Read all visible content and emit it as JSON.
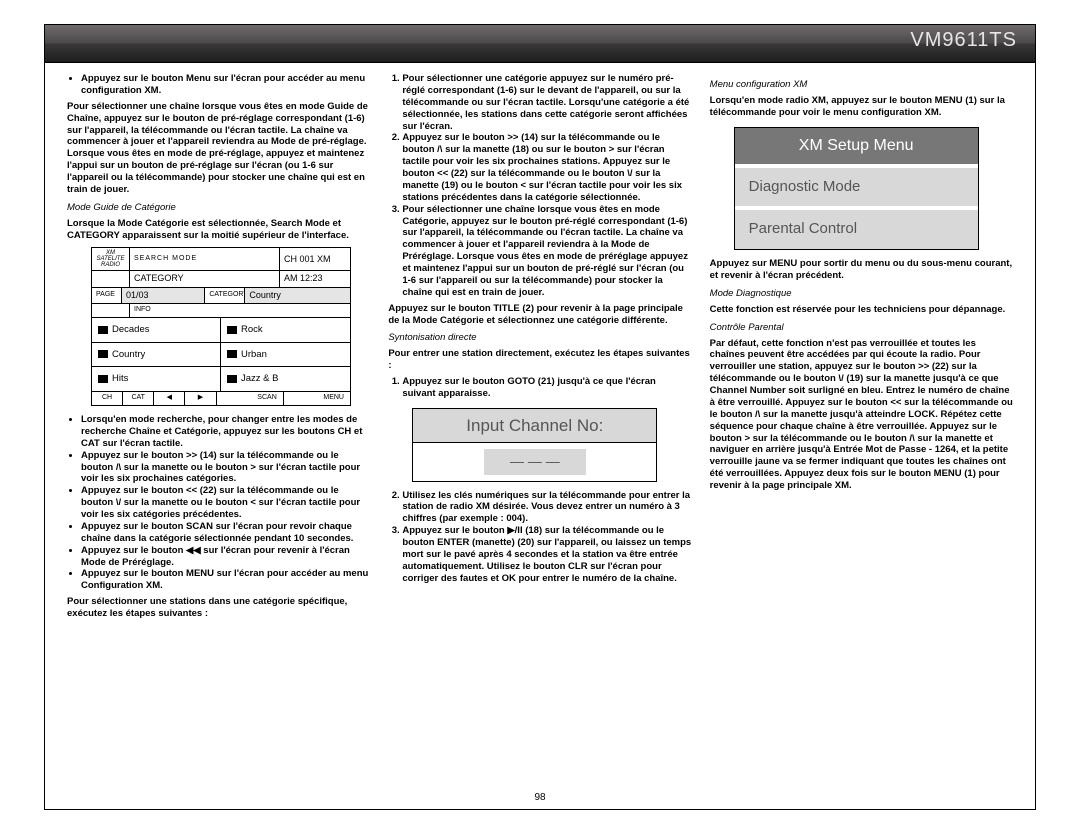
{
  "header": {
    "product_id": "VM9611TS"
  },
  "page_number": "98",
  "col1": {
    "bullet1": "Appuyez sur le bouton Menu sur l'écran pour accéder au menu configuration XM.",
    "para1": "Pour sélectionner une chaîne lorsque vous êtes en mode Guide de Chaîne, appuyez sur le bouton de pré-réglage correspondant (1-6) sur l'appareil, la télécommande ou l'écran tactile. La chaîne va commencer à jouer et l'appareil reviendra au Mode de pré-réglage. Lorsque vous êtes en mode de pré-réglage, appuyez et maintenez l'appui sur un bouton de pré-réglage sur l'écran (ou 1-6 sur l'appareil ou la télécommande) pour stocker une chaîne qui est en train de jouer.",
    "sec_label": "Mode Guide de Catégorie",
    "para2": "Lorsque la Mode Catégorie est sélectionnée, Search Mode et CATEGORY apparaissent sur la moitié supérieur de l'interface.",
    "diagram": {
      "logo": "XM SATELITE RADIO",
      "search_mode": "SEARCH MODE",
      "ch": "CH 001   XM",
      "category": "CATEGORY",
      "time": "AM 12:23",
      "page_lbl": "PAGE",
      "page_val": "01/03",
      "cat_lbl": "CATEGORY",
      "cat_val": "Country",
      "info": "INFO",
      "folders": [
        "Decades",
        "Rock",
        "Country",
        "Urban",
        "Hits",
        "Jazz & B"
      ],
      "btns": [
        "CH",
        "CAT",
        "◀",
        "▶",
        "SCAN",
        "MENU"
      ]
    },
    "b2": "Lorsqu'en mode recherche, pour changer entre les modes de recherche Chaîne et Catégorie, appuyez sur les boutons CH et CAT sur l'écran tactile.",
    "b3": "Appuyez sur le bouton >> (14) sur la télécommande ou le bouton /\\ sur la manette ou le bouton > sur l'écran tactile pour voir les six prochaines catégories.",
    "b4": "Appuyez sur le bouton << (22) sur la télécommande ou le bouton \\/ sur la manette ou le bouton < sur l'écran tactile pour voir les six catégories précédentes.",
    "b5": "Appuyez sur le bouton SCAN sur l'écran pour revoir chaque chaîne dans la catégorie sélectionnée pendant 10 secondes.",
    "b6": "Appuyez sur le bouton ◀◀ sur l'écran pour revenir à l'écran Mode de Préréglage.",
    "b7": "Appuyez sur le bouton MENU sur l'écran pour accéder au menu Configuration XM.",
    "para3": "Pour sélectionner une stations dans une catégorie spécifique, exécutez les étapes suivantes :"
  },
  "col2": {
    "o1": "Pour sélectionner une catégorie appuyez sur le numéro pré-réglé correspondant (1-6) sur le devant de l'appareil, ou sur la télécommande ou sur l'écran tactile. Lorsqu'une catégorie a été sélectionnée, les stations dans cette catégorie seront affichées sur l'écran.",
    "o2": "Appuyez sur le bouton >> (14) sur la télécommande ou le bouton /\\ sur la manette (18) ou sur le bouton > sur l'écran tactile pour voir les six prochaines stations. Appuyez sur le bouton << (22) sur la télécommande ou le bouton \\/ sur la manette (19) ou le bouton < sur l'écran tactile pour voir les six stations précédentes dans la catégorie sélectionnée.",
    "o3": "Pour sélectionner une chaîne lorsque vous êtes en mode Catégorie, appuyez sur le bouton pré-réglé correspondant (1-6) sur l'appareil, la télécommande ou l'écran tactile. La chaîne va commencer à jouer et l'appareil reviendra à la Mode de Préréglage. Lorsque vous êtes en mode de préréglage appuyez et maintenez l'appui sur un bouton de pré-réglé sur l'écran (ou 1-6 sur l'appareil ou sur la télécommande) pour stocker la chaîne qui est en train de jouer.",
    "p1": "Appuyez sur le bouton TITLE (2) pour revenir à la page principale de la Mode Catégorie et sélectionnez une catégorie différente.",
    "sec_label": "Syntonisation directe",
    "p2": "Pour entrer une station directement, exécutez les étapes suivantes :",
    "o4": "Appuyez sur le bouton GOTO (21) jusqu'à ce que l'écran suivant apparaisse.",
    "input": {
      "title": "Input Channel No:",
      "dashes": "— — —"
    },
    "o5": "Utilisez les clés numériques sur la télécommande pour entrer la station de radio XM désirée. Vous devez entrer un numéro à 3 chiffres (par exemple : 004).",
    "o6": "Appuyez sur le bouton ▶/II (18) sur la télécommande ou le bouton ENTER (manette) (20) sur l'appareil, ou laissez un temps mort sur le pavé après 4 secondes et la station va être entrée automatiquement. Utilisez le bouton CLR sur l'écran pour corriger des fautes et OK pour entrer le numéro de la chaîne."
  },
  "col3": {
    "sec1": "Menu configuration XM",
    "p1": "Lorsqu'en mode radio XM, appuyez sur le bouton MENU (1) sur la télécommande pour voir le menu configuration XM.",
    "setup": {
      "title": "XM Setup Menu",
      "item1": "Diagnostic Mode",
      "item2": "Parental Control"
    },
    "p2": "Appuyez sur MENU pour sortir du menu ou du sous-menu courant, et revenir à l'écran précédent.",
    "sec2": "Mode Diagnostique",
    "p3": "Cette fonction est réservée pour les techniciens pour dépannage.",
    "sec3": "Contrôle Parental",
    "p4": "Par défaut, cette fonction n'est pas verrouillée et toutes les chaînes peuvent être accédées par qui écoute la radio. Pour verrouiller une station, appuyez sur le bouton >> (22) sur la télécommande ou le bouton \\/ (19) sur la manette jusqu'à ce que Channel Number soit surligné en bleu. Entrez le numéro de chaîne à être verrouillé. Appuyez sur le bouton << sur la télécommande ou le bouton /\\ sur la manette jusqu'à atteindre LOCK. Répétez cette séquence pour chaque chaîne à être verrouillée. Appuyez sur le bouton > sur la télécommande ou le bouton /\\ sur la manette et naviguer en arrière jusqu'à Entrée Mot de Passe - 1264, et la petite verrouille jaune va se fermer indiquant que toutes les chaînes ont été verrouillées. Appuyez deux fois sur le bouton MENU (1) pour revenir à la page principale XM."
  }
}
